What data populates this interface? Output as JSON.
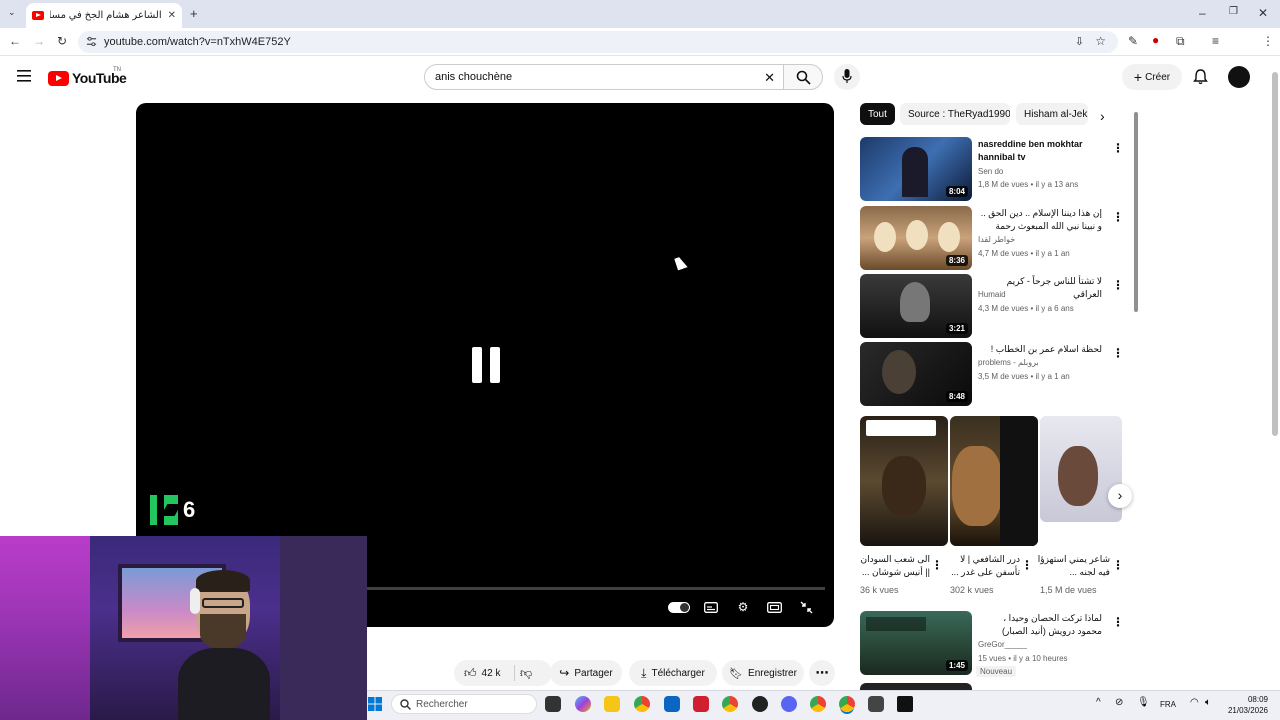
{
  "browser": {
    "tab_title": "الشاعر هشام الجخ في مسابقة أمير الشعراء",
    "new_tab_symbol": "+",
    "url": "youtube.com/watch?v=nTxhW4E752Y"
  },
  "header": {
    "logo_text": "YouTube",
    "logo_country": "TN",
    "search_value": "anis chouchène",
    "create_label": "Créer"
  },
  "player": {
    "overlay_badge_number": "6",
    "progress": 0.0
  },
  "actions": {
    "likes": "42 k",
    "share": "Partager",
    "download": "Télécharger",
    "save": "Enregistrer"
  },
  "sidebar": {
    "chips": [
      "Tout",
      "Source : TheRyad1990",
      "Hisham al-Jekh"
    ],
    "videos": [
      {
        "title": "nasreddine ben mokhtar hannibal tv",
        "channel": "Sen do",
        "meta": "1,8 M de vues • il y a 13 ans",
        "duration": "8:04"
      },
      {
        "title": "إن هذا ديننا الإسلام .. دين الحق .. و نبينا نبي الله المبعوث رحمة للعالمين ..",
        "channel": "خواطر لقدا",
        "meta": "4,7 M de vues • il y a 1 an",
        "duration": "8:36"
      },
      {
        "title": "لا تشتأ للناس جرحاً - كريم العراقي",
        "channel": "Humaid",
        "meta": "4,3 M de vues • il y a 6 ans",
        "duration": "3:21"
      },
      {
        "title": "لحظة اسلام عمر بن الخطاب !",
        "channel": "problems - بروبلم",
        "meta": "3,5 M de vues • il y a 1 an",
        "duration": "8:48"
      }
    ],
    "shorts": [
      {
        "title": "الى شعب السودان || أنيس شوشان ...",
        "views": "36 k vues"
      },
      {
        "title": "درر الشافعي | لا تأسفن على غدر ...",
        "views": "302 k vues"
      },
      {
        "title": "شاعر يمني استهزؤا فيه لجنه ...",
        "views": "1,5 M de vues"
      }
    ],
    "last_video": {
      "title": "لماذا تركت الحصان وحيدا ، محمود درويش (أنيد الصبار)",
      "channel": "GreGor_____",
      "meta": "15 vues • il y a 10 heures",
      "badge": "Nouveau",
      "duration": "1:45"
    }
  },
  "taskbar": {
    "search_placeholder": "Rechercher",
    "language": "FRA",
    "time": "08:09",
    "date": "21/03/2026"
  }
}
